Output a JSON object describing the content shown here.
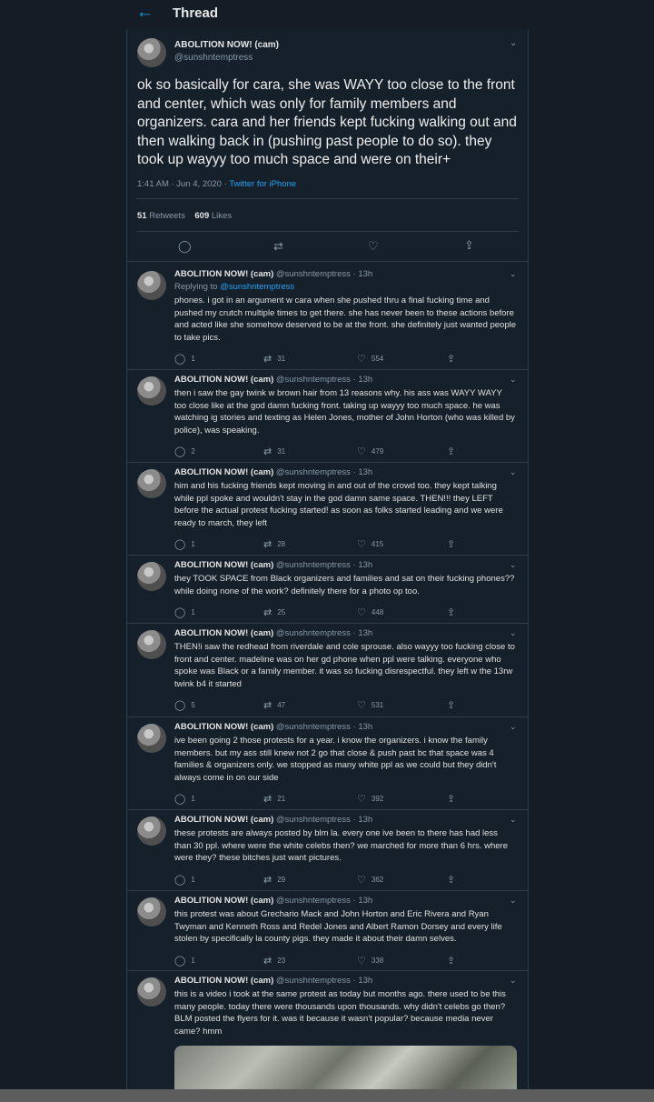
{
  "header": {
    "back_icon": "back-arrow-icon",
    "title": "Thread"
  },
  "main_tweet": {
    "name": "ABOLITION NOW! (cam)",
    "handle": "@sunshntemptress",
    "text": "ok so basically for cara, she was WAYY too close to the front and center, which was only for family members and organizers. cara and her friends kept fucking walking out and then walking back in (pushing past people to do so). they took up wayyy too much space and were on their+",
    "time": "1:41 AM · Jun 4, 2020 · ",
    "source": "Twitter for iPhone",
    "retweets": "51",
    "retweets_label": "Retweets",
    "likes": "609",
    "likes_label": "Likes"
  },
  "replies": [
    {
      "name": "ABOLITION NOW! (cam)",
      "handle": "@sunshntemptress",
      "time": "· 13h",
      "replying_prefix": "Replying to ",
      "replying_to": "@sunshntemptress",
      "text": "phones. i got in an argument w cara when she pushed thru a final fucking time and pushed my crutch multiple times to get there. she has never been to these actions before and acted like she somehow deserved to be at the front. she definitely just wanted people to take pics.",
      "replies": "1",
      "retweets": "31",
      "likes": "554"
    },
    {
      "name": "ABOLITION NOW! (cam)",
      "handle": "@sunshntemptress",
      "time": "· 13h",
      "text": "then i saw the gay twink w brown hair from 13 reasons why. his ass was WAYY WAYY too close like at the god damn fucking front. taking up wayyy too much space. he was watching ig stories and texting as Helen Jones, mother of John Horton (who was killed by police), was speaking.",
      "replies": "2",
      "retweets": "31",
      "likes": "479"
    },
    {
      "name": "ABOLITION NOW! (cam)",
      "handle": "@sunshntemptress",
      "time": "· 13h",
      "text": "him and his fucking friends kept moving in and out of the crowd too. they kept talking while ppl spoke and wouldn't stay in the god damn same space. THEN!!! they LEFT before the actual protest fucking started! as soon as folks started leading and we were ready to march, they left",
      "replies": "1",
      "retweets": "28",
      "likes": "415"
    },
    {
      "name": "ABOLITION NOW! (cam)",
      "handle": "@sunshntemptress",
      "time": "· 13h",
      "text": "they TOOK SPACE from Black organizers and families and sat on their fucking phones?? while doing none of the work? definitely there for a photo op too.",
      "replies": "1",
      "retweets": "25",
      "likes": "448"
    },
    {
      "name": "ABOLITION NOW! (cam)",
      "handle": "@sunshntemptress",
      "time": "· 13h",
      "text": "THEN!i saw the redhead from riverdale and cole sprouse. also wayyy too fucking close to front and center. madeline was on her gd phone when ppl were talking. everyone who spoke was Black or a family member. it was so fucking disrespectful. they left w the 13rw twink b4 it started",
      "replies": "5",
      "retweets": "47",
      "likes": "531"
    },
    {
      "name": "ABOLITION NOW! (cam)",
      "handle": "@sunshntemptress",
      "time": "· 13h",
      "text": "ive been going 2 those protests for a year. i know the organizers. i know the family members. but my ass still knew not 2 go that close & push past bc that space was 4 families & organizers only. we stopped as many white ppl as we could but they didn't always come in on our side",
      "replies": "1",
      "retweets": "21",
      "likes": "392"
    },
    {
      "name": "ABOLITION NOW! (cam)",
      "handle": "@sunshntemptress",
      "time": "· 13h",
      "text": "these protests are always posted by blm la. every one ive been to there has had less than 30 ppl. where were the white celebs then? we marched for more than 6 hrs. where were they? these bitches just want pictures.",
      "replies": "1",
      "retweets": "29",
      "likes": "362"
    },
    {
      "name": "ABOLITION NOW! (cam)",
      "handle": "@sunshntemptress",
      "time": "· 13h",
      "text": "this protest was about Grechario Mack and John Horton and Eric Rivera and Ryan Twyman and Kenneth Ross and Redel Jones and Albert Ramon Dorsey and every life stolen by specifically la county pigs. they made it about their damn selves.",
      "replies": "1",
      "retweets": "23",
      "likes": "338"
    },
    {
      "name": "ABOLITION NOW! (cam)",
      "handle": "@sunshntemptress",
      "time": "· 13h",
      "text": "this is a video i took at the same protest as today but months ago. there used to be this many people. today there were thousands upon thousands. why didn't celebs go then? BLM posted the flyers for it. was it because it wasn't popular? because media never came? hmm"
    }
  ],
  "icons": {
    "reply": "reply-icon",
    "retweet": "retweet-icon",
    "like": "heart-icon",
    "share": "share-icon",
    "more": "chevron-down-icon"
  }
}
